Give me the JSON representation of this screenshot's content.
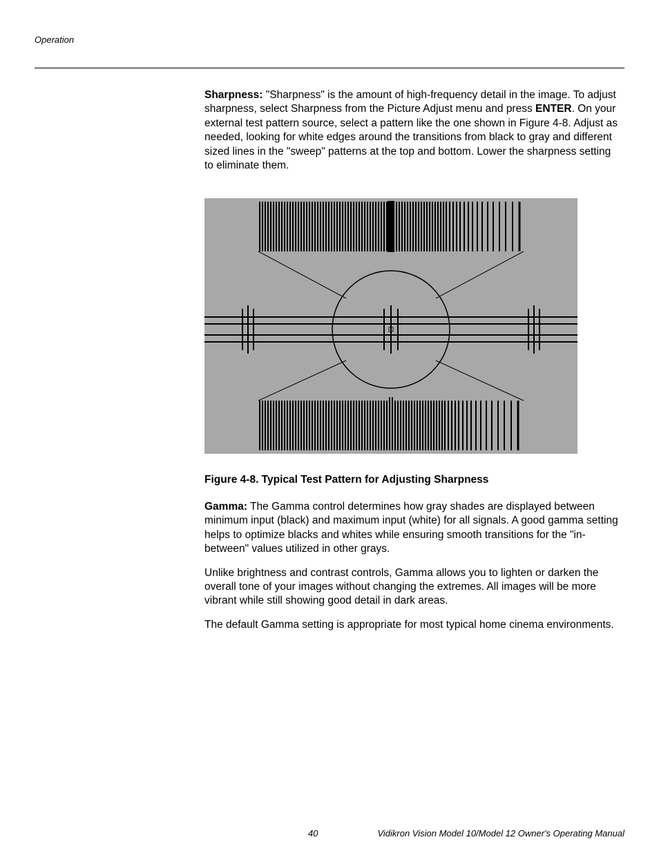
{
  "header": {
    "section": "Operation"
  },
  "body": {
    "sharpness": {
      "label": "Sharpness:",
      "text_part1": " \"Sharpness\" is the amount of high-frequency detail in the image. To adjust sharpness, select Sharpness from the Picture Adjust menu and press ",
      "enter": "ENTER",
      "text_part2": ". On your external test pattern source, select a pattern like the one shown in Figure 4-8. Adjust as needed, looking for white edges around the transitions from black to gray and different sized lines in the \"sweep\" patterns at the top and bottom. Lower the sharpness setting to eliminate them."
    },
    "figure_caption": "Figure 4-8. Typical Test Pattern for Adjusting Sharpness",
    "gamma": {
      "label": "Gamma:",
      "p1": " The Gamma control determines how gray shades are displayed between minimum input (black) and maximum input (white) for all signals. A good gamma setting helps to optimize blacks and whites while ensuring smooth transitions for the \"in-between\" values utilized in other grays.",
      "p2": "Unlike brightness and contrast controls, Gamma allows you to lighten or darken the overall tone of your images without changing the extremes. All images will be more vibrant while still showing good detail in dark areas.",
      "p3": "The default Gamma setting is appropriate for most typical home cinema environments."
    }
  },
  "footer": {
    "page": "40",
    "title": "Vidikron Vision Model 10/Model 12 Owner's Operating Manual"
  }
}
